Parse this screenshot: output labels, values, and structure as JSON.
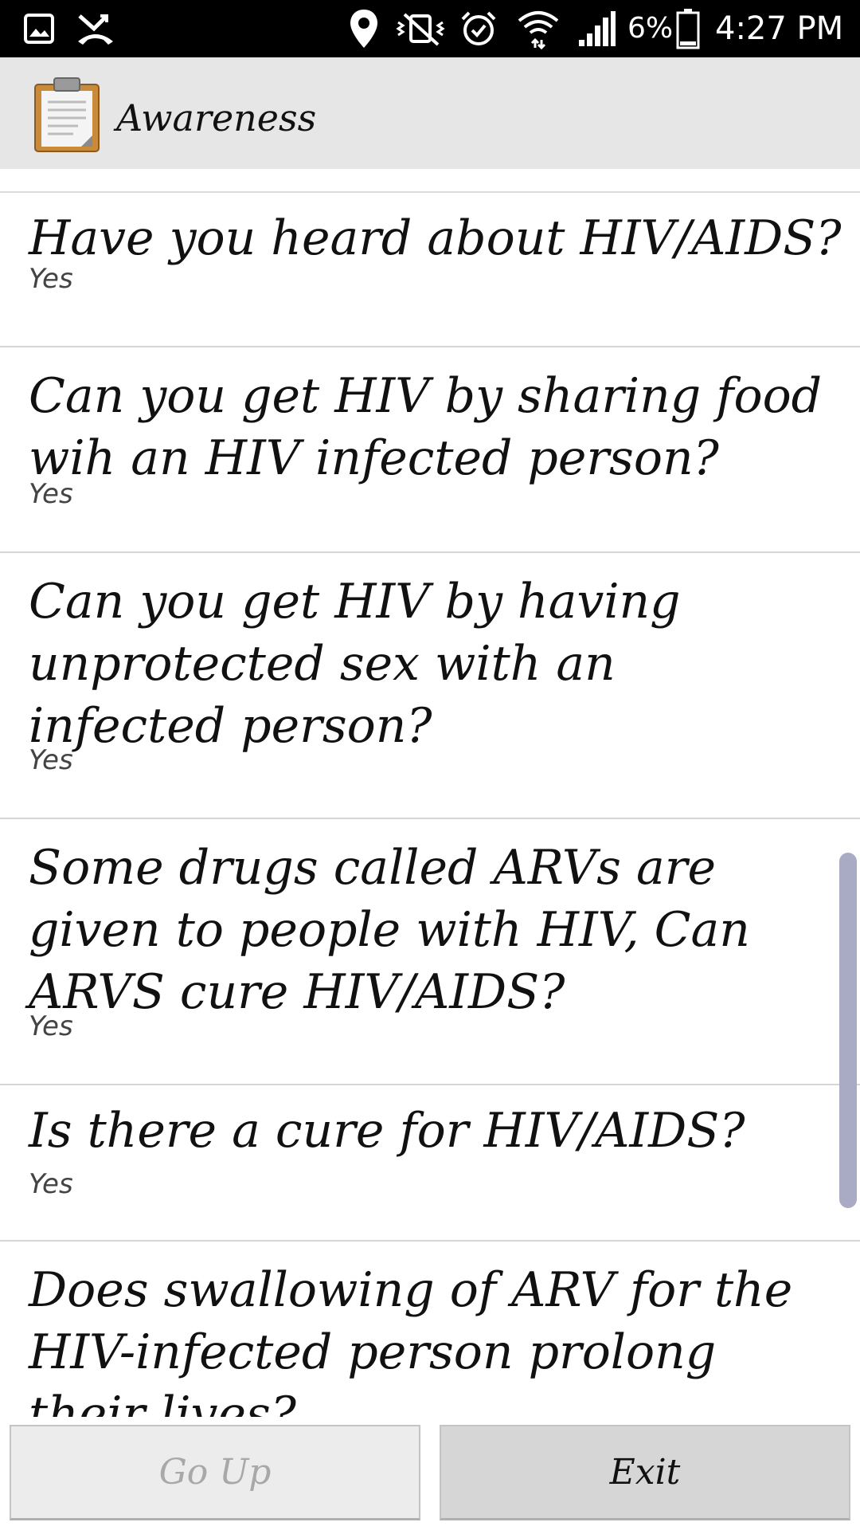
{
  "status_bar": {
    "icons": [
      "gallery-icon",
      "missed-call-icon",
      "location-icon",
      "vibrate-mute-icon",
      "alarm-icon",
      "wifi-icon",
      "signal-icon",
      "battery-icon"
    ],
    "battery_percent": "6%",
    "time": "4:27 PM"
  },
  "action_bar": {
    "title": "Awareness",
    "icon": "clipboard-icon"
  },
  "questions": [
    {
      "question": "Have you heard about HIV/AIDS?",
      "answer": "Yes"
    },
    {
      "question": "Can you get HIV by sharing food wih an HIV infected person?",
      "answer": "Yes"
    },
    {
      "question": "Can you get HIV by having unprotected sex with an infected person?",
      "answer": "Yes"
    },
    {
      "question": "Some drugs called ARVs are given to people with HIV, Can ARVS cure HIV/AIDS?",
      "answer": "Yes"
    },
    {
      "question": "Is there a cure for HIV/AIDS?",
      "answer": "Yes"
    },
    {
      "question": "Does swallowing of ARV for the HIV-infected person prolong their lives?",
      "answer": ""
    }
  ],
  "buttons": {
    "go_up": "Go Up",
    "exit": "Exit"
  }
}
